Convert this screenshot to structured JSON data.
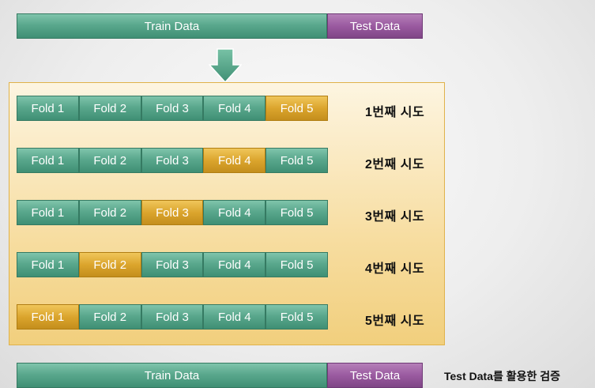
{
  "top_split": {
    "train_label": "Train Data",
    "test_label": "Test Data"
  },
  "folds": {
    "labels": [
      "Fold 1",
      "Fold 2",
      "Fold 3",
      "Fold 4",
      "Fold 5"
    ],
    "trials": [
      {
        "label": "1번째 시도",
        "validation_fold": 5
      },
      {
        "label": "2번째 시도",
        "validation_fold": 4
      },
      {
        "label": "3번째 시도",
        "validation_fold": 3
      },
      {
        "label": "4번째 시도",
        "validation_fold": 2
      },
      {
        "label": "5번째 시도",
        "validation_fold": 1
      }
    ]
  },
  "bottom_split": {
    "train_label": "Train Data",
    "test_label": "Test Data",
    "caption": "Test Data를 활용한 검증"
  },
  "colors": {
    "train": "#5aa88d",
    "test": "#9a5aa0",
    "validation": "#dba52d",
    "arrow": "#4f9e80"
  },
  "icons": {
    "arrow": "down-arrow-icon"
  }
}
